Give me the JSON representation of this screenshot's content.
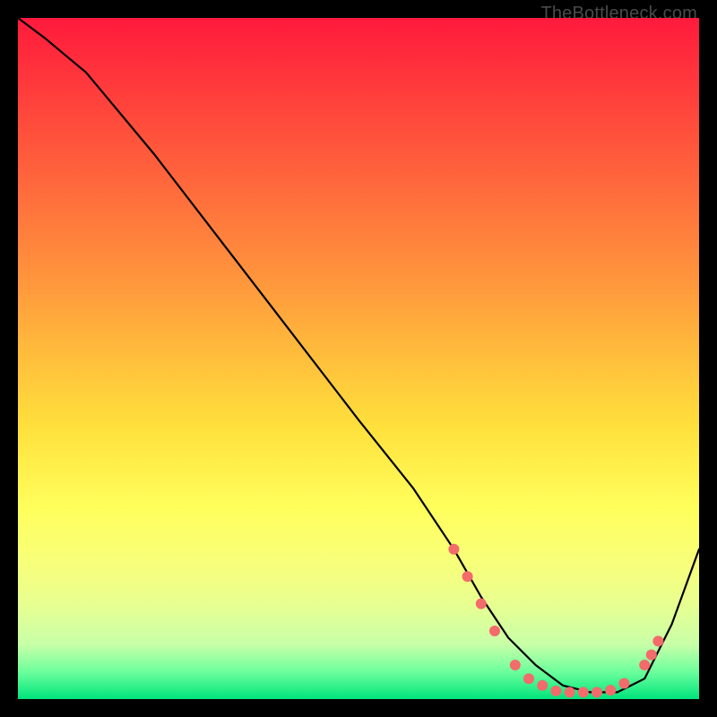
{
  "watermark": "TheBottleneck.com",
  "chart_data": {
    "type": "line",
    "title": "",
    "xlabel": "",
    "ylabel": "",
    "xlim": [
      0,
      100
    ],
    "ylim": [
      0,
      100
    ],
    "background_gradient": {
      "top_color": "#ff1a3c",
      "mid_color": "#ffe03c",
      "bottom_color": "#00e47c",
      "direction": "vertical"
    },
    "series": [
      {
        "name": "bottleneck-curve",
        "x": [
          0,
          4,
          10,
          20,
          30,
          40,
          50,
          58,
          64,
          68,
          72,
          76,
          80,
          84,
          88,
          92,
          96,
          100
        ],
        "y": [
          100,
          97,
          92,
          80,
          67,
          54,
          41,
          31,
          22,
          15,
          9,
          5,
          2,
          1,
          1,
          3,
          11,
          22
        ]
      }
    ],
    "markers": {
      "name": "highlight-dots",
      "color": "#f36b6b",
      "points": [
        {
          "x": 64,
          "y": 22
        },
        {
          "x": 66,
          "y": 18
        },
        {
          "x": 68,
          "y": 14
        },
        {
          "x": 70,
          "y": 10
        },
        {
          "x": 73,
          "y": 5
        },
        {
          "x": 75,
          "y": 3
        },
        {
          "x": 77,
          "y": 2
        },
        {
          "x": 79,
          "y": 1.2
        },
        {
          "x": 81,
          "y": 1
        },
        {
          "x": 83,
          "y": 1
        },
        {
          "x": 85,
          "y": 1
        },
        {
          "x": 87,
          "y": 1.3
        },
        {
          "x": 89,
          "y": 2.3
        },
        {
          "x": 92,
          "y": 5
        },
        {
          "x": 93,
          "y": 6.5
        },
        {
          "x": 94,
          "y": 8.5
        }
      ]
    }
  }
}
